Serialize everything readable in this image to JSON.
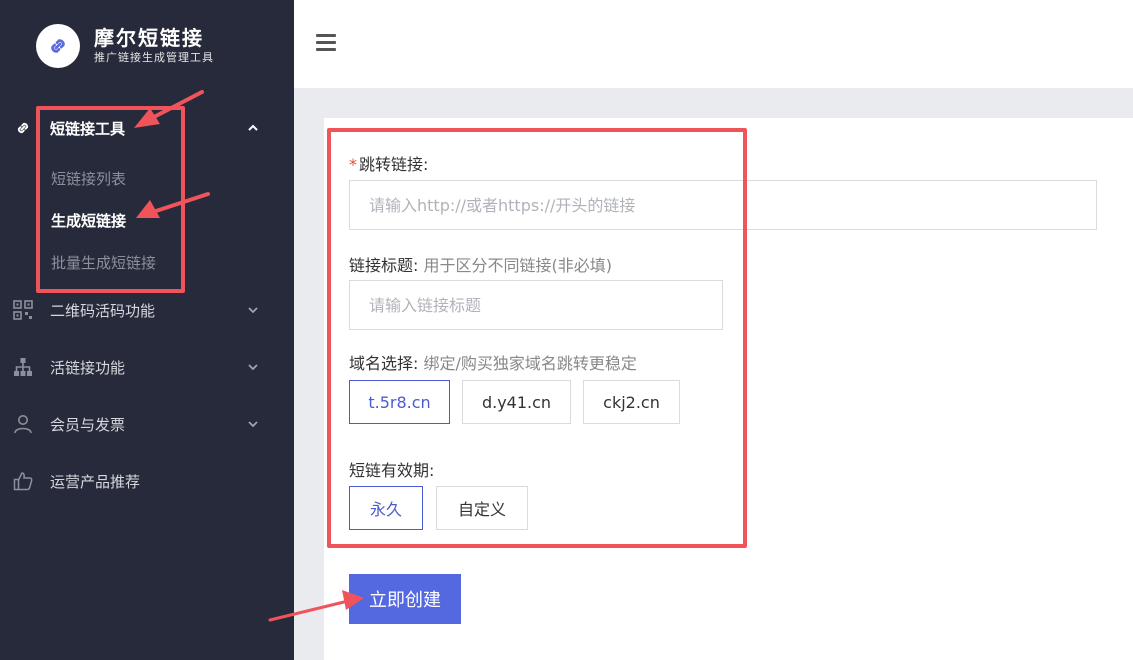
{
  "brand": {
    "title": "摩尔短链接",
    "subtitle": "推广链接生成管理工具"
  },
  "sidebar": {
    "groups": [
      {
        "label": "短链接工具",
        "icon": "link-icon",
        "expanded": true,
        "children": [
          {
            "label": "短链接列表",
            "active": false
          },
          {
            "label": "生成短链接",
            "active": true
          },
          {
            "label": "批量生成短链接",
            "active": false
          }
        ]
      },
      {
        "label": "二维码活码功能",
        "icon": "qrcode-icon",
        "expanded": false
      },
      {
        "label": "活链接功能",
        "icon": "sitemap-icon",
        "expanded": false
      },
      {
        "label": "会员与发票",
        "icon": "user-icon",
        "expanded": false
      },
      {
        "label": "运营产品推荐",
        "icon": "thumbs-up-icon",
        "expanded": false
      }
    ]
  },
  "topbar": {
    "menu_icon": "hamburger-icon"
  },
  "form": {
    "redirect": {
      "required_mark": "*",
      "label": "跳转链接:",
      "placeholder": "请输入http://或者https://开头的链接",
      "value": ""
    },
    "title": {
      "label": "链接标题:",
      "hint": "用于区分不同链接(非必填)",
      "placeholder": "请输入链接标题",
      "value": ""
    },
    "domain": {
      "label": "域名选择:",
      "hint": "绑定/购买独家域名跳转更稳定",
      "options": [
        "t.5r8.cn",
        "d.y41.cn",
        "ckj2.cn"
      ],
      "selected": "t.5r8.cn"
    },
    "validity": {
      "label": "短链有效期:",
      "options": [
        "永久",
        "自定义"
      ],
      "selected": "永久"
    },
    "submit_label": "立即创建"
  },
  "colors": {
    "sidebar_bg": "#262a3a",
    "accent": "#5468e0",
    "selected_border": "#4a5bd1",
    "annotation": "#f0545a"
  }
}
